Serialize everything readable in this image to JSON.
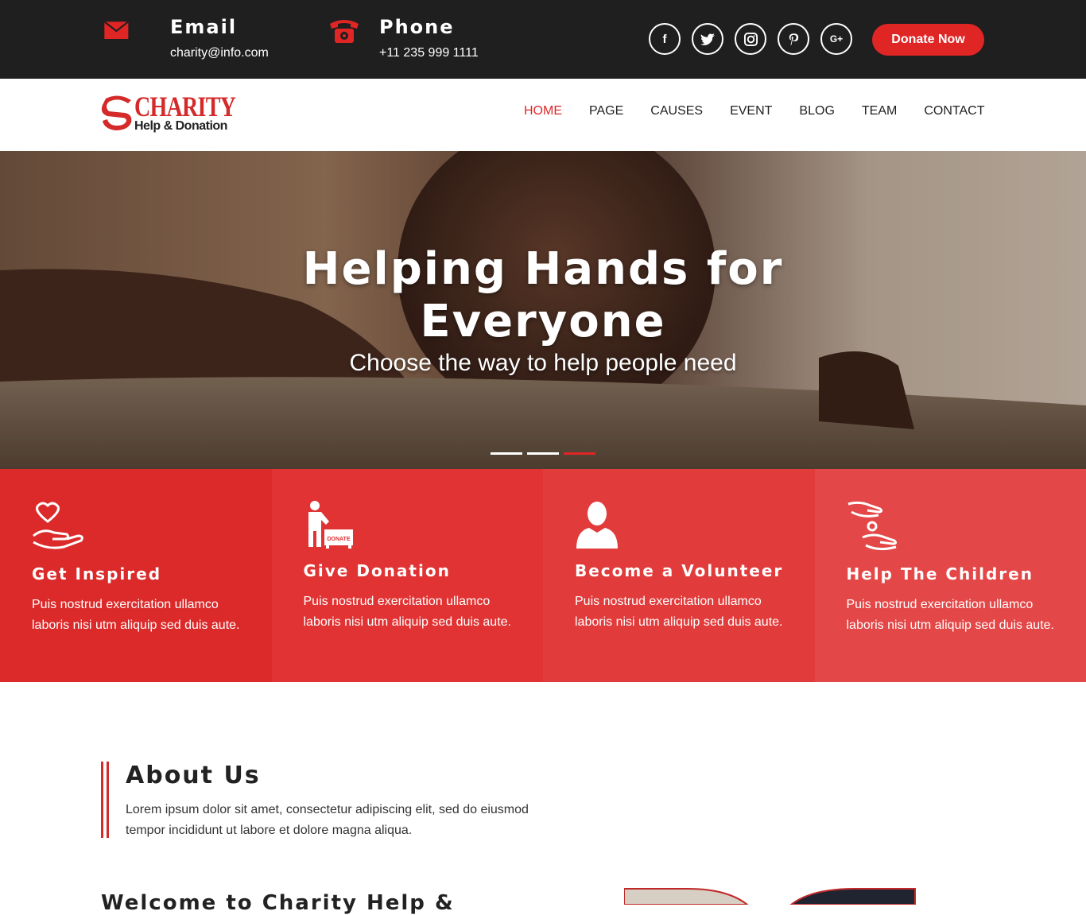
{
  "topbar": {
    "email": {
      "label": "Email",
      "value": "charity@info.com"
    },
    "phone": {
      "label": "Phone",
      "value": "+11 235 999 1111"
    },
    "socials": [
      {
        "name": "facebook",
        "glyph": "f"
      },
      {
        "name": "twitter",
        "glyph": "t"
      },
      {
        "name": "instagram",
        "glyph": "ig"
      },
      {
        "name": "pinterest",
        "glyph": "p"
      },
      {
        "name": "google-plus",
        "glyph": "G+"
      }
    ],
    "donate_label": "Donate Now"
  },
  "logo": {
    "title": "CHARITY",
    "subtitle": "Help & Donation"
  },
  "nav": {
    "items": [
      "HOME",
      "PAGE",
      "CAUSES",
      "EVENT",
      "BLOG",
      "TEAM",
      "CONTACT"
    ],
    "active": "HOME"
  },
  "hero": {
    "title_line1": "Helping Hands for",
    "title_line2": "Everyone",
    "subtitle": "Choose the way to help people need",
    "slides": 3,
    "active_slide": 3
  },
  "features": [
    {
      "title": "Get Inspired",
      "text": "Puis nostrud exercitation ullamco laboris nisi utm aliquip sed duis aute.",
      "icon": "heart-hand-icon",
      "color": "#dc2a2a"
    },
    {
      "title": "Give Donation",
      "text": "Puis nostrud exercitation ullamco laboris nisi utm aliquip sed duis aute.",
      "icon": "donate-box-icon",
      "color": "#e13333"
    },
    {
      "title": "Become a Volunteer",
      "text": "Puis nostrud exercitation ullamco laboris nisi utm aliquip sed duis aute.",
      "icon": "person-icon",
      "color": "#e23b3b"
    },
    {
      "title": "Help The Children",
      "text": "Puis nostrud exercitation ullamco laboris nisi utm aliquip sed duis aute.",
      "icon": "helping-hands-icon",
      "color": "#e44747"
    }
  ],
  "donate_sign_text": "DONATE",
  "about": {
    "title": "About Us",
    "text": "Lorem ipsum dolor sit amet, consectetur adipiscing elit, sed do eiusmod tempor incididunt ut labore et dolore magna aliqua."
  },
  "welcome_title": "Welcome to Charity Help &",
  "colors": {
    "accent": "#e02525",
    "topbar": "#1f1f1f"
  }
}
